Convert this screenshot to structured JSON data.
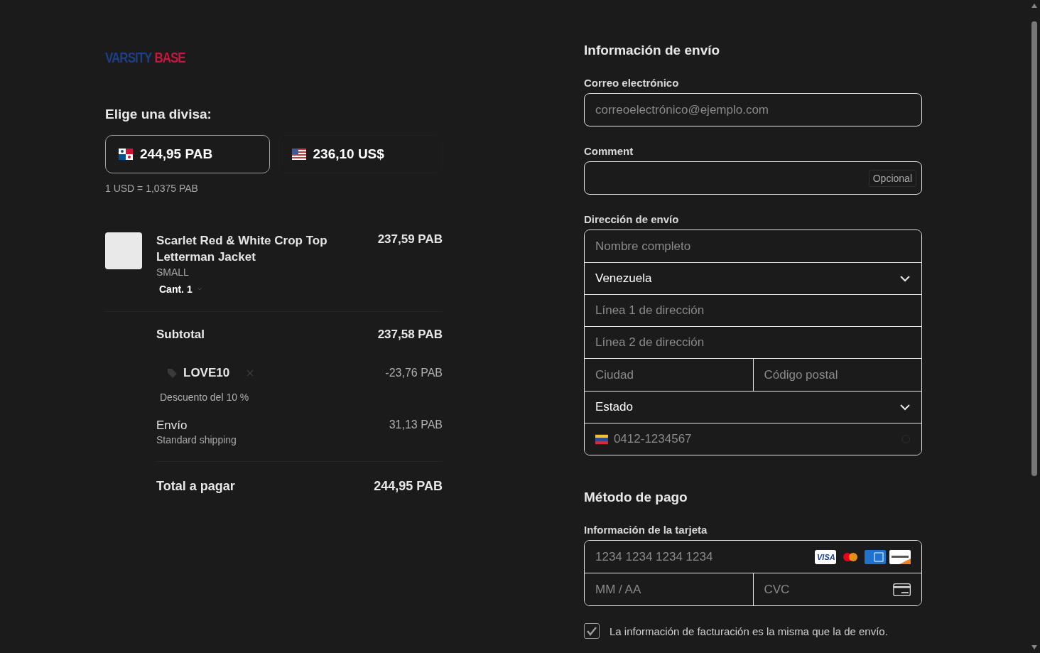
{
  "logo": {
    "primary": "VARSITY",
    "accent": "BASE"
  },
  "currency": {
    "title": "Elige una divisa:",
    "options": [
      {
        "kind": "panama",
        "amount": "244,95 PAB",
        "selected": true
      },
      {
        "kind": "usa",
        "amount": "236,10 US$",
        "selected": false
      }
    ],
    "rate": "1 USD = 1,0375 PAB"
  },
  "order": {
    "items": [
      {
        "name": "Scarlet Red & White Crop Top Letterman Jacket",
        "variant": "SMALL",
        "quantity": "Cant. 1",
        "price": "237,59 PAB"
      }
    ],
    "subtotal": {
      "label": "Subtotal",
      "value": "237,58 PAB"
    },
    "discount": {
      "code": "LOVE10",
      "amount": "-23,76 PAB",
      "description": "Descuento del 10 %"
    },
    "shipping": {
      "label": "Envío",
      "method": "Standard shipping",
      "value": "31,13 PAB"
    },
    "total": {
      "label": "Total a pagar",
      "value": "244,95 PAB"
    }
  },
  "shipping_info": {
    "title": "Información de envío",
    "email": {
      "label": "Correo electrónico",
      "placeholder": "correoelectrónico@ejemplo.com"
    },
    "comment": {
      "label": "Comment",
      "badge": "Opcional"
    },
    "address": {
      "label": "Dirección de envío",
      "fields": [
        {
          "kind": "text",
          "placeholder": "Nombre completo"
        },
        {
          "kind": "select",
          "value": "Venezuela"
        },
        {
          "kind": "text",
          "placeholder": "Línea 1 de dirección"
        },
        {
          "kind": "text",
          "placeholder": "Línea 2 de dirección"
        },
        {
          "kind": "pair",
          "placeholders": [
            "Ciudad",
            "Código postal"
          ]
        },
        {
          "kind": "select",
          "value": "Estado"
        },
        {
          "kind": "phone",
          "placeholder": "0412-1234567"
        }
      ]
    }
  },
  "payment": {
    "title": "Método de pago",
    "card": {
      "label": "Información de la tarjeta",
      "number_placeholder": "1234 1234 1234 1234",
      "brand_label": "VISA",
      "expiry_placeholder": "MM / AA",
      "cvc_placeholder": "CVC"
    },
    "billing_same": {
      "label": "La información de facturación es la misma que la de envío.",
      "checked": true
    }
  }
}
